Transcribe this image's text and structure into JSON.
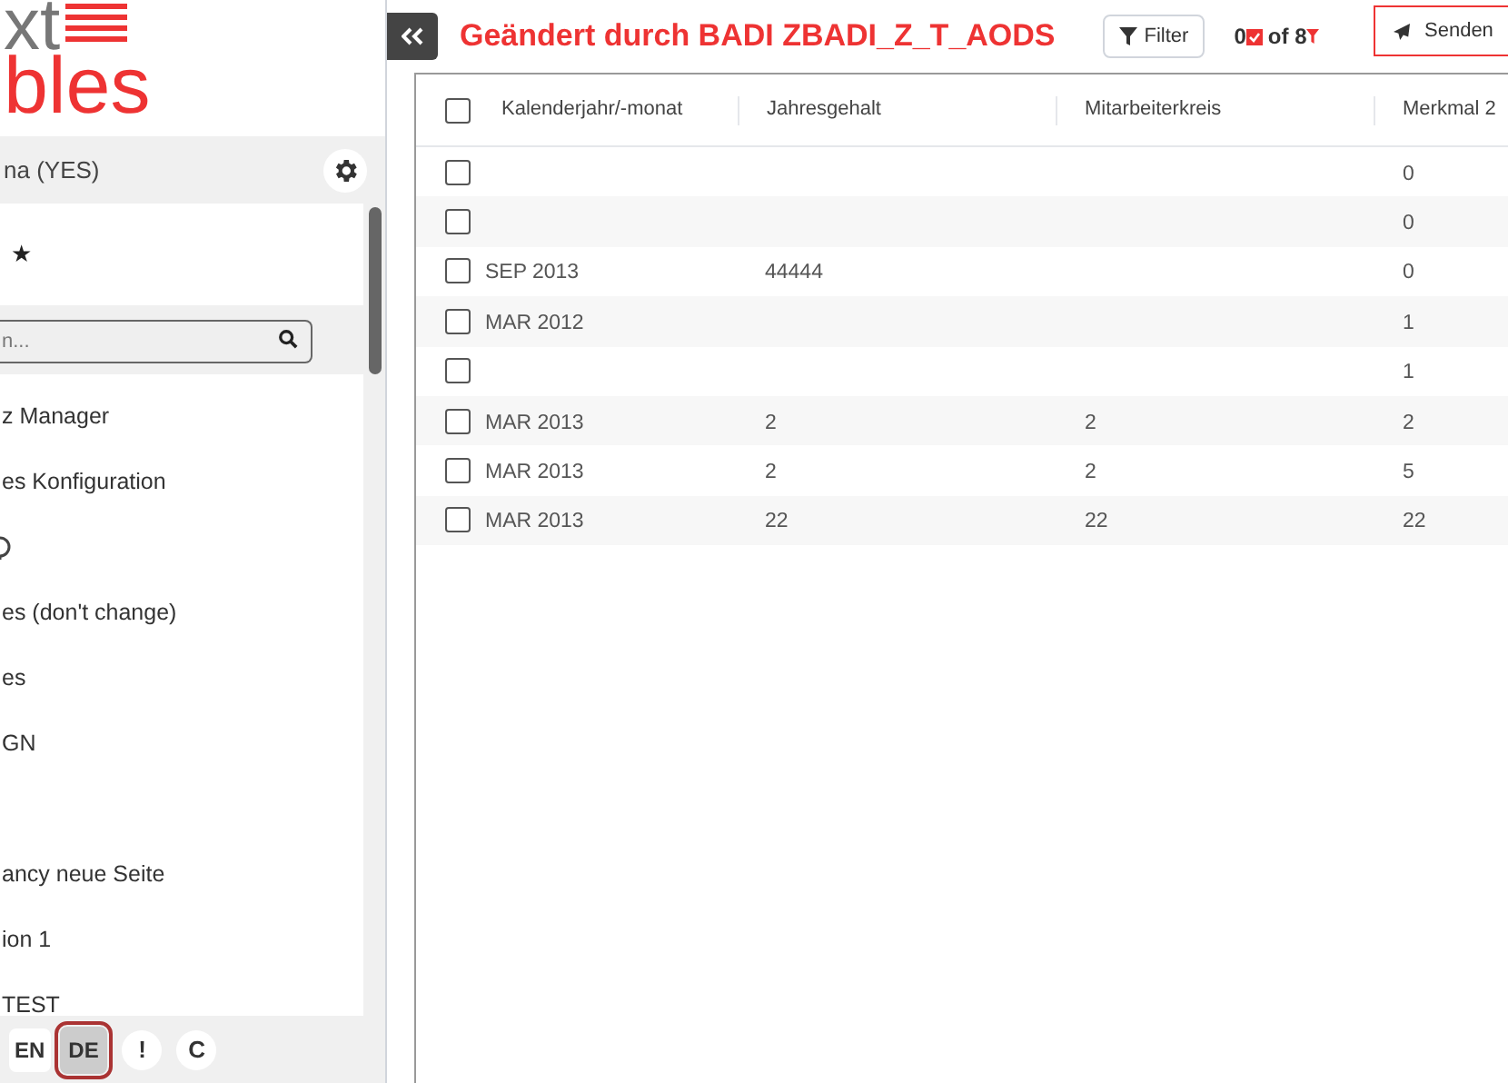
{
  "sidebar": {
    "logo": {
      "line_1": "xt",
      "line_2": "bles"
    },
    "system": "na (YES)",
    "favorites": "★",
    "search": {
      "placeholder": "n..."
    },
    "items": [
      {
        "label": "z Manager",
        "kind": "text"
      },
      {
        "label": "es Konfiguration",
        "kind": "text"
      },
      {
        "kind": "icon"
      },
      {
        "label": "es (don't change)",
        "kind": "text"
      },
      {
        "label": "es",
        "kind": "text"
      },
      {
        "label": "GN",
        "kind": "text"
      },
      {
        "kind": "blank"
      },
      {
        "label": "ancy neue Seite",
        "kind": "text"
      },
      {
        "label": "ion 1",
        "kind": "text"
      },
      {
        "label": "TEST",
        "kind": "text"
      }
    ],
    "languages": [
      {
        "label": "EN",
        "selected": false
      },
      {
        "label": "DE",
        "selected": true
      }
    ],
    "buttons": [
      "!",
      "C"
    ]
  },
  "header": {
    "title": "Geändert durch BADI ZBADI_Z_T_AODS",
    "filter": "Filter",
    "count_1": "0",
    "count_2": "of 8",
    "send": "Senden"
  },
  "table": {
    "all_checked": false,
    "columns": [
      "Kalenderjahr/-monat",
      "Jahresgehalt",
      "Mitarbeiterkreis",
      "Merkmal 2"
    ],
    "rows": [
      {
        "checked": false,
        "cells": [
          "",
          "",
          "",
          "0"
        ]
      },
      {
        "checked": false,
        "cells": [
          "",
          "",
          "",
          "0"
        ]
      },
      {
        "checked": false,
        "cells": [
          "SEP 2013",
          "44444",
          "",
          "0"
        ]
      },
      {
        "checked": false,
        "cells": [
          "MAR 2012",
          "",
          "",
          "1"
        ]
      },
      {
        "checked": false,
        "cells": [
          "",
          "",
          "",
          "1"
        ]
      },
      {
        "checked": false,
        "cells": [
          "MAR 2013",
          "2",
          "2",
          "2"
        ]
      },
      {
        "checked": false,
        "cells": [
          "MAR 2013",
          "2",
          "2",
          "5"
        ]
      },
      {
        "checked": false,
        "cells": [
          "MAR 2013",
          "22",
          "22",
          "22"
        ]
      }
    ]
  }
}
